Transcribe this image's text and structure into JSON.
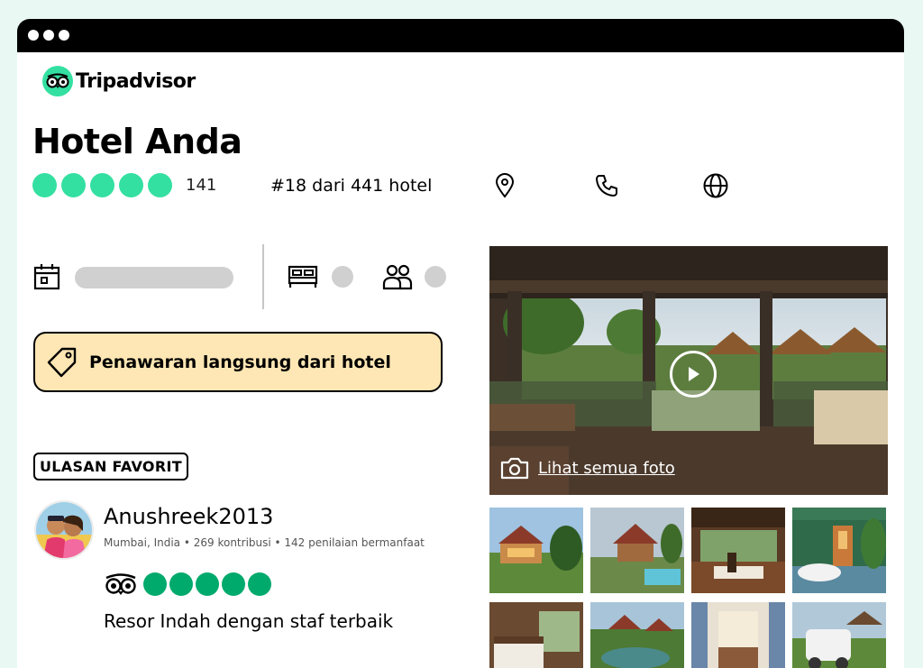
{
  "brand": {
    "name": "Tripadvisor",
    "logo_icon": "owl-logo-icon",
    "accent": "#34e0a1"
  },
  "hotel": {
    "title": "Hotel Anda",
    "bubble_rating": 5,
    "review_count": "141",
    "ranking": "#18 dari 441 hotel",
    "action_icons": [
      "location-pin-icon",
      "phone-icon",
      "globe-icon"
    ]
  },
  "booking": {
    "icons": [
      "calendar-icon",
      "bed-icon",
      "guests-icon"
    ]
  },
  "offer": {
    "label": "Penawaran langsung dari hotel",
    "icon": "tag-icon",
    "bg": "#fee7b4"
  },
  "review": {
    "badge": "ULASAN FAVORIT",
    "name": "Anushreek2013",
    "meta": "Mumbai, India • 269 kontribusi • 142 penilaian bermanfaat",
    "rating": 5,
    "title": "Resor Indah dengan staf terbaik",
    "bubble_color": "#00aa6c"
  },
  "gallery": {
    "see_all": "Lihat semua foto",
    "icons": [
      "camera-icon",
      "play-icon"
    ]
  }
}
